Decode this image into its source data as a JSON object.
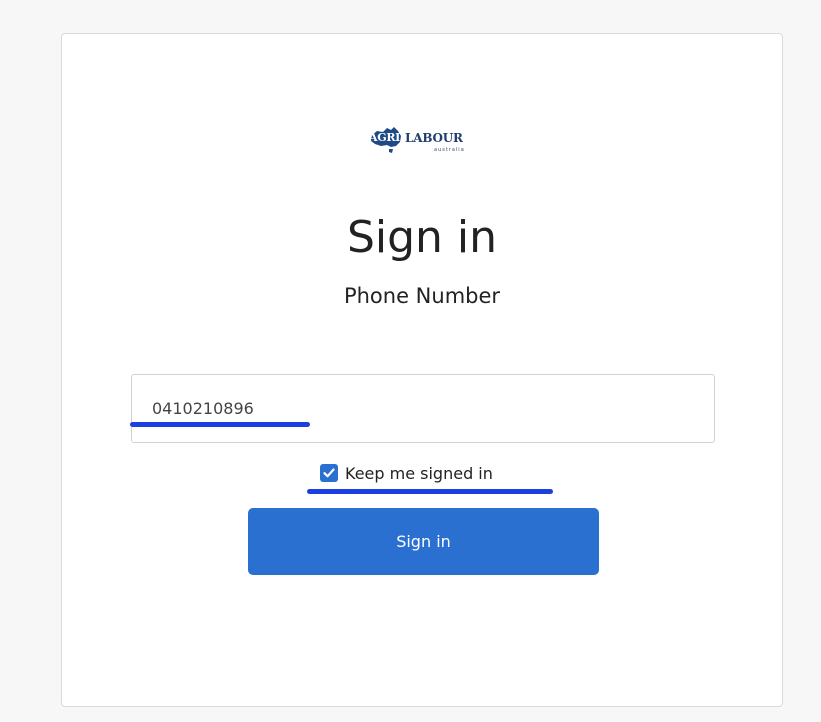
{
  "logo": {
    "agri": "AGRI",
    "labour": "LABOUR",
    "sub": "australia"
  },
  "title": "Sign in",
  "subtitle": "Phone Number",
  "phone": {
    "value": "0410210896"
  },
  "remember": {
    "label": "Keep me signed in",
    "checked": true
  },
  "signin_button": {
    "label": "Sign in"
  },
  "colors": {
    "primary": "#2a70d0",
    "highlight": "#1b3fe0"
  }
}
